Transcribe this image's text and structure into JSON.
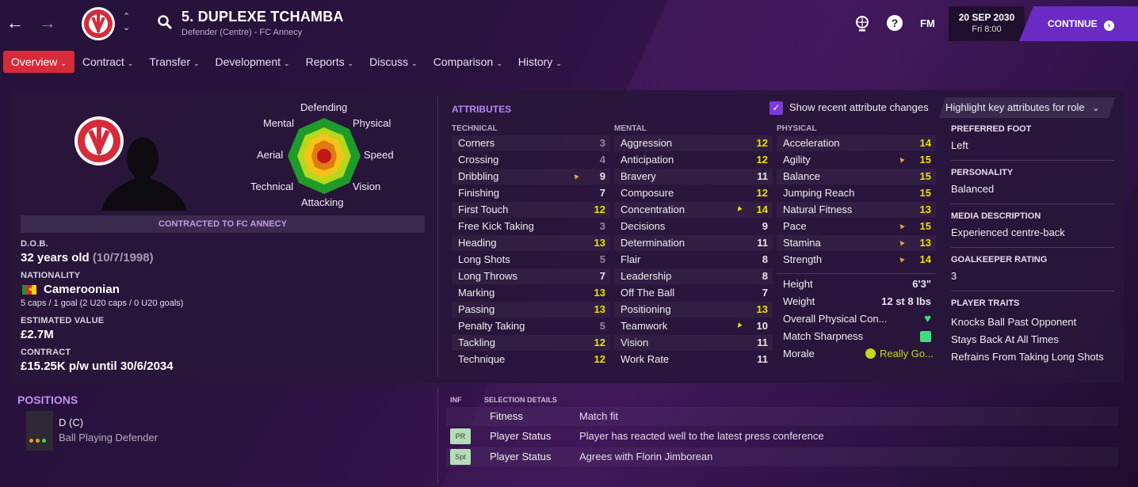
{
  "header": {
    "player_title": "5. DUPLEXE TCHAMBA",
    "player_subtitle": "Defender (Centre) - FC Annecy",
    "fm_label": "FM",
    "date": "20 SEP 2030",
    "time": "Fri 8:00",
    "continue_label": "CONTINUE"
  },
  "tabs": [
    {
      "label": "Overview"
    },
    {
      "label": "Contract"
    },
    {
      "label": "Transfer"
    },
    {
      "label": "Development"
    },
    {
      "label": "Reports"
    },
    {
      "label": "Discuss"
    },
    {
      "label": "Comparison"
    },
    {
      "label": "History"
    }
  ],
  "radar": {
    "top": "Defending",
    "left_top": "Mental",
    "right_top": "Physical",
    "left_mid": "Aerial",
    "right_mid": "Speed",
    "left_bot": "Technical",
    "right_bot": "Vision",
    "bottom": "Attacking"
  },
  "profile": {
    "contracted": "CONTRACTED TO FC ANNECY",
    "dob_label": "D.O.B.",
    "age": "32 years old",
    "dob": "(10/7/1998)",
    "nationality_label": "NATIONALITY",
    "nationality": "Cameroonian",
    "caps": "5 caps / 1 goal (2 U20 caps / 0 U20 goals)",
    "value_label": "ESTIMATED VALUE",
    "value": "£2.7M",
    "contract_label": "CONTRACT",
    "contract": "£15.25K p/w until 30/6/2034"
  },
  "attributes": {
    "title": "ATTRIBUTES",
    "show_changes_label": "Show recent attribute changes",
    "highlight_label": "Highlight key attributes for role",
    "technical_label": "TECHNICAL",
    "mental_label": "MENTAL",
    "physical_label": "PHYSICAL",
    "technical": [
      {
        "name": "Corners",
        "value": "3"
      },
      {
        "name": "Crossing",
        "value": "4"
      },
      {
        "name": "Dribbling",
        "value": "9"
      },
      {
        "name": "Finishing",
        "value": "7"
      },
      {
        "name": "First Touch",
        "value": "12"
      },
      {
        "name": "Free Kick Taking",
        "value": "3"
      },
      {
        "name": "Heading",
        "value": "13"
      },
      {
        "name": "Long Shots",
        "value": "5"
      },
      {
        "name": "Long Throws",
        "value": "7"
      },
      {
        "name": "Marking",
        "value": "13"
      },
      {
        "name": "Passing",
        "value": "13"
      },
      {
        "name": "Penalty Taking",
        "value": "5"
      },
      {
        "name": "Tackling",
        "value": "12"
      },
      {
        "name": "Technique",
        "value": "12"
      }
    ],
    "mental": [
      {
        "name": "Aggression",
        "value": "12"
      },
      {
        "name": "Anticipation",
        "value": "12"
      },
      {
        "name": "Bravery",
        "value": "11"
      },
      {
        "name": "Composure",
        "value": "12"
      },
      {
        "name": "Concentration",
        "value": "14"
      },
      {
        "name": "Decisions",
        "value": "9"
      },
      {
        "name": "Determination",
        "value": "11"
      },
      {
        "name": "Flair",
        "value": "8"
      },
      {
        "name": "Leadership",
        "value": "8"
      },
      {
        "name": "Off The Ball",
        "value": "7"
      },
      {
        "name": "Positioning",
        "value": "13"
      },
      {
        "name": "Teamwork",
        "value": "10"
      },
      {
        "name": "Vision",
        "value": "11"
      },
      {
        "name": "Work Rate",
        "value": "11"
      }
    ],
    "physical": [
      {
        "name": "Acceleration",
        "value": "14"
      },
      {
        "name": "Agility",
        "value": "15"
      },
      {
        "name": "Balance",
        "value": "15"
      },
      {
        "name": "Jumping Reach",
        "value": "15"
      },
      {
        "name": "Natural Fitness",
        "value": "13"
      },
      {
        "name": "Pace",
        "value": "15"
      },
      {
        "name": "Stamina",
        "value": "13"
      },
      {
        "name": "Strength",
        "value": "14"
      }
    ],
    "extra": [
      {
        "name": "Height",
        "value": "6'3\""
      },
      {
        "name": "Weight",
        "value": "12 st 8 lbs"
      },
      {
        "name": "Overall Physical Con...",
        "value": ""
      },
      {
        "name": "Match Sharpness",
        "value": ""
      },
      {
        "name": "Morale",
        "value": "Really Go..."
      }
    ]
  },
  "right": {
    "foot_label": "PREFERRED FOOT",
    "foot": "Left",
    "personality_label": "PERSONALITY",
    "personality": "Balanced",
    "media_label": "MEDIA DESCRIPTION",
    "media": "Experienced centre-back",
    "gk_label": "GOALKEEPER RATING",
    "gk": "3",
    "traits_label": "PLAYER TRAITS",
    "traits": [
      "Knocks Ball Past Opponent",
      "Stays Back At All Times",
      "Refrains From Taking Long Shots"
    ]
  },
  "positions": {
    "title": "POSITIONS",
    "pos": "D (C)",
    "role": "Ball Playing Defender"
  },
  "selection": {
    "inf_label": "INF",
    "details_label": "SELECTION DETAILS",
    "rows": [
      {
        "tag": "",
        "a": "Fitness",
        "b": "Match fit"
      },
      {
        "tag": "PR",
        "a": "Player Status",
        "b": "Player has reacted well to the latest press conference"
      },
      {
        "tag": "Spt",
        "a": "Player Status",
        "b": "Agrees with Florin Jimborean"
      }
    ]
  },
  "colors": {
    "accent_red": "#d52b3a",
    "accent_purple": "#6a2bc4",
    "highlight_yellow": "#e8e200",
    "fitness_green": "#3ddc84"
  }
}
